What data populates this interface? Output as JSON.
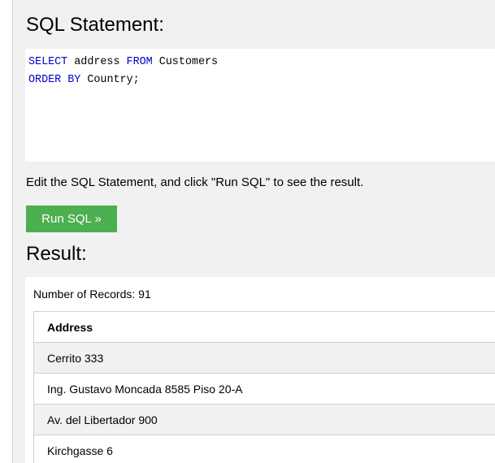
{
  "sql_section": {
    "heading": "SQL Statement:",
    "statement": {
      "line1": {
        "kw1": "SELECT",
        "text1": " address ",
        "kw2": "FROM",
        "text2": " Customers"
      },
      "line2": {
        "kw1": "ORDER BY",
        "text1": " Country;"
      }
    }
  },
  "instructions": "Edit the SQL Statement, and click \"Run SQL\" to see the result.",
  "run_button": {
    "label": "Run SQL »",
    "color": "#4caf50"
  },
  "result_section": {
    "heading": "Result:",
    "record_count": "Number of Records: 91",
    "table": {
      "columns": [
        "Address"
      ],
      "rows": [
        [
          "Cerrito 333"
        ],
        [
          "Ing. Gustavo Moncada 8585 Piso 20-A"
        ],
        [
          "Av. del Libertador 900"
        ],
        [
          "Kirchgasse 6"
        ]
      ]
    }
  },
  "colors": {
    "panel_background": "#f1f1f1",
    "keyword": "#0000cd",
    "border": "#d0d0d0"
  }
}
